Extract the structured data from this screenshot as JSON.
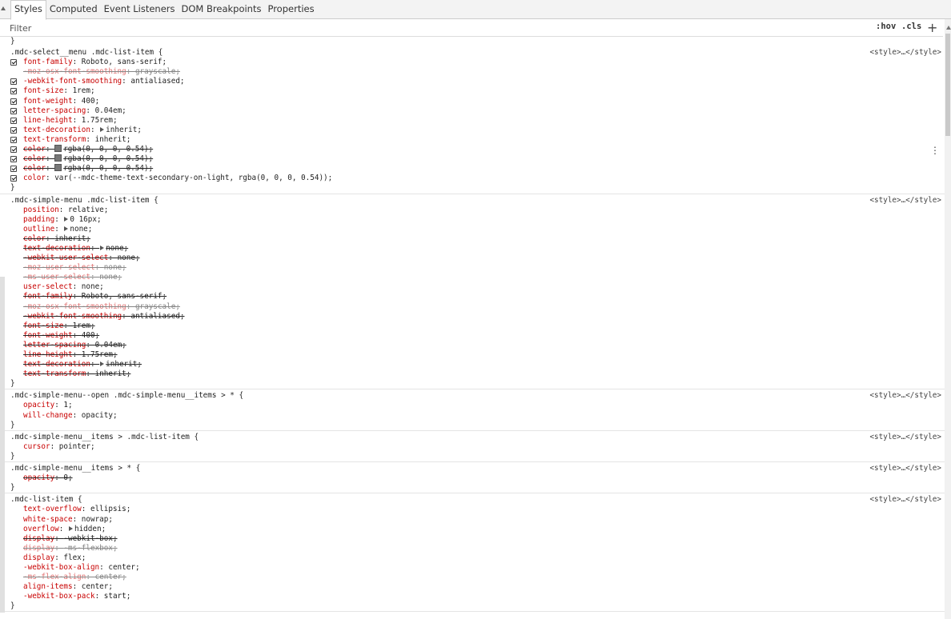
{
  "tabs": [
    {
      "label": "Styles",
      "active": true
    },
    {
      "label": "Computed",
      "active": false
    },
    {
      "label": "Event Listeners",
      "active": false
    },
    {
      "label": "DOM Breakpoints",
      "active": false
    },
    {
      "label": "Properties",
      "active": false
    }
  ],
  "filter": {
    "placeholder": "Filter",
    "value": ""
  },
  "buttons": {
    "hov": ":hov",
    "cls": ".cls",
    "add": "+"
  },
  "source_label": "<style>…</style>",
  "rules": [
    {
      "selector": ".mdc-select__menu .mdc-list-item {",
      "source": "<style>…</style>",
      "declarations": [
        {
          "prop": "font-family",
          "value": "Roboto, sans-serif;",
          "checkbox": true
        },
        {
          "prop": "-moz-osx-font-smoothing",
          "value": "grayscale;",
          "strike": true,
          "dim": true
        },
        {
          "prop": "-webkit-font-smoothing",
          "value": "antialiased;",
          "checkbox": true
        },
        {
          "prop": "font-size",
          "value": "1rem;",
          "checkbox": true
        },
        {
          "prop": "font-weight",
          "value": "400;",
          "checkbox": true
        },
        {
          "prop": "letter-spacing",
          "value": "0.04em;",
          "checkbox": true
        },
        {
          "prop": "line-height",
          "value": "1.75rem;",
          "checkbox": true
        },
        {
          "prop": "text-decoration",
          "value": "inherit;",
          "checkbox": true,
          "triangle": true
        },
        {
          "prop": "text-transform",
          "value": "inherit;",
          "checkbox": true
        },
        {
          "prop": "color",
          "value": "rgba(0, 0, 0, 0.54);",
          "checkbox": true,
          "strike": true,
          "swatch": true
        },
        {
          "prop": "color",
          "value": "rgba(0, 0, 0, 0.54);",
          "checkbox": true,
          "strike": true,
          "swatch": true
        },
        {
          "prop": "color",
          "value": "rgba(0, 0, 0, 0.54);",
          "checkbox": true,
          "strike": true,
          "swatch": true
        },
        {
          "prop": "color",
          "value": "var(--mdc-theme-text-secondary-on-light, rgba(0, 0, 0, 0.54));",
          "checkbox": true
        }
      ]
    },
    {
      "selector": ".mdc-simple-menu .mdc-list-item {",
      "source": "<style>…</style>",
      "declarations": [
        {
          "prop": "position",
          "value": "relative;"
        },
        {
          "prop": "padding",
          "value": "0 16px;",
          "triangle": true
        },
        {
          "prop": "outline",
          "value": "none;",
          "triangle": true
        },
        {
          "prop": "color",
          "value": "inherit;",
          "strike": true
        },
        {
          "prop": "text-decoration",
          "value": "none;",
          "strike": true,
          "triangle": true
        },
        {
          "prop": "-webkit-user-select",
          "value": "none;",
          "strike": true
        },
        {
          "prop": "-moz-user-select",
          "value": "none;",
          "strike": true,
          "dim": true
        },
        {
          "prop": "-ms-user-select",
          "value": "none;",
          "strike": true,
          "dim": true
        },
        {
          "prop": "user-select",
          "value": "none;"
        },
        {
          "prop": "font-family",
          "value": "Roboto, sans-serif;",
          "strike": true
        },
        {
          "prop": "-moz-osx-font-smoothing",
          "value": "grayscale;",
          "strike": true,
          "dim": true
        },
        {
          "prop": "-webkit-font-smoothing",
          "value": "antialiased;",
          "strike": true
        },
        {
          "prop": "font-size",
          "value": "1rem;",
          "strike": true
        },
        {
          "prop": "font-weight",
          "value": "400;",
          "strike": true
        },
        {
          "prop": "letter-spacing",
          "value": "0.04em;",
          "strike": true
        },
        {
          "prop": "line-height",
          "value": "1.75rem;",
          "strike": true
        },
        {
          "prop": "text-decoration",
          "value": "inherit;",
          "strike": true,
          "triangle": true
        },
        {
          "prop": "text-transform",
          "value": "inherit;",
          "strike": true
        }
      ]
    },
    {
      "selector": ".mdc-simple-menu--open .mdc-simple-menu__items > * {",
      "source": "<style>…</style>",
      "declarations": [
        {
          "prop": "opacity",
          "value": "1;"
        },
        {
          "prop": "will-change",
          "value": "opacity;"
        }
      ]
    },
    {
      "selector": ".mdc-simple-menu__items > .mdc-list-item {",
      "source": "<style>…</style>",
      "declarations": [
        {
          "prop": "cursor",
          "value": "pointer;"
        }
      ]
    },
    {
      "selector": ".mdc-simple-menu__items > * {",
      "source": "<style>…</style>",
      "declarations": [
        {
          "prop": "opacity",
          "value": "0;",
          "strike": true
        }
      ]
    },
    {
      "selector": ".mdc-list-item {",
      "source": "<style>…</style>",
      "declarations": [
        {
          "prop": "text-overflow",
          "value": "ellipsis;"
        },
        {
          "prop": "white-space",
          "value": "nowrap;"
        },
        {
          "prop": "overflow",
          "value": "hidden;",
          "triangle": true
        },
        {
          "prop": "display",
          "value": "-webkit-box;",
          "strike": true
        },
        {
          "prop": "display",
          "value": "-ms-flexbox;",
          "strike": true,
          "dim": true
        },
        {
          "prop": "display",
          "value": "flex;"
        },
        {
          "prop": "-webkit-box-align",
          "value": "center;"
        },
        {
          "prop": "-ms-flex-align",
          "value": "center;",
          "strike": true,
          "dim": true
        },
        {
          "prop": "align-items",
          "value": "center;"
        },
        {
          "prop": "-webkit-box-pack",
          "value": "start;"
        }
      ]
    }
  ]
}
